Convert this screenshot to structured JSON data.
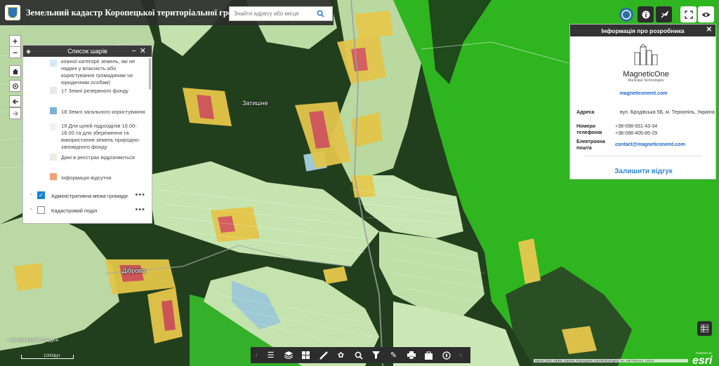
{
  "header": {
    "title": "Земельний кадастр Коропецької територіальної громади",
    "search_placeholder": "Знайти адресу або місце"
  },
  "map": {
    "place_labels": [
      "Затишне",
      "Діброва"
    ],
    "coordinates": "25,162 48,988 Градуси",
    "scale_label": "1000фут",
    "attribution": "Maxar | Esri, HERE, Garmin, Foursquare, GeoTechnologies, Inc, METI/NASA, USGS",
    "esri_powered": "POWERED BY",
    "esri_word": "esri",
    "colors": {
      "forest": "#1f4a1e",
      "field_green": "#2fb31f",
      "parcel_light": "#c9e6b7",
      "parcel_yellow": "#e7c84a",
      "parcel_red": "#d9565b"
    }
  },
  "layer_panel": {
    "title": "Список шарів",
    "legend": [
      {
        "text": "кожної категорії земель, які не надані у власність або користування громадянам чи юридичним особам)",
        "color": "#d4e9f7"
      },
      {
        "text": "17 Землі резервного фонду",
        "color": "#e8e8e8"
      },
      {
        "text": "18 Землі загального користування",
        "color": "#7fb0d9"
      },
      {
        "text": "19 Для цілей підрозділів 16.00-18.00 та для збереження та використання земель природно-заповідного фонду",
        "color": "#edf2f5"
      },
      {
        "text": "Дані в реєстрах відрізняються",
        "color": "#eeeae2"
      },
      {
        "text": "Інформація відсутня",
        "color": "#f0a27a"
      }
    ],
    "layers": [
      {
        "label": "Адміністративна межа громади",
        "checked": true
      },
      {
        "label": "Кадастровий поділ",
        "checked": false
      }
    ]
  },
  "info_panel": {
    "title": "Інформація про розробника",
    "brand_name": "MagneticOne",
    "brand_sub": "Municipal Technologies",
    "site": "magneticonemt.com",
    "address_label": "Адреса",
    "address": "вул. Бродівська 5Б, м. Тернопіль, Україна",
    "phones_label": "Номери телефонів",
    "phone1": "+38-098-931-43-34",
    "phone2": "+38-098-405-85-29",
    "email_label": "Електронна пошта",
    "email": "contact@magneticonemt.com",
    "feedback": "Залишити відгук"
  }
}
